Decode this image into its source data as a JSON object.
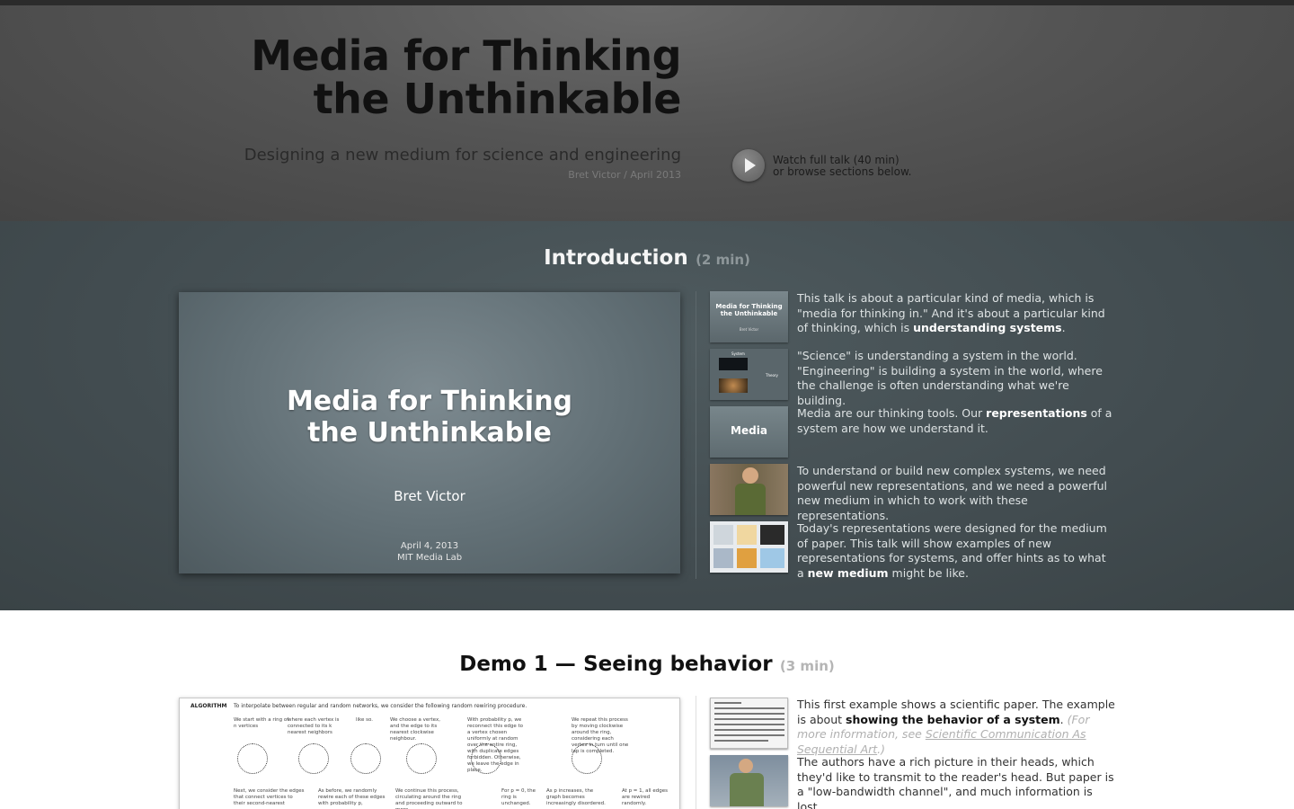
{
  "header": {
    "title_line1": "Media for Thinking",
    "title_line2": "the Unthinkable",
    "subtitle": "Designing a new medium for science and engineering",
    "byline": "Bret Victor / April 2013",
    "watch_line1": "Watch full talk (40 min)",
    "watch_line2": "or browse sections below."
  },
  "intro": {
    "title": "Introduction",
    "duration": "(2 min)",
    "slide": {
      "title_line1": "Media for Thinking",
      "title_line2": "the Unthinkable",
      "author": "Bret Victor",
      "date": "April 4, 2013",
      "venue": "MIT Media Lab"
    },
    "thumbs": {
      "t1_title": "Media for Thinking the Unthinkable",
      "t1_sub": "Bret Victor",
      "t2_system": "System",
      "t2_theory": "Theory",
      "t3_label": "Media"
    },
    "items": [
      {
        "pre": "This talk is about a particular kind of media, which is \"media for thinking in.\" And it's about a particular kind of thinking, which is ",
        "bold": "understanding systems",
        "post": "."
      },
      {
        "pre": "\"Science\" is understanding a system in the world. \"Engineering\" is building a system in the world, where the challenge is often understanding what we're building.",
        "bold": "",
        "post": ""
      },
      {
        "pre": "Media are our thinking tools. Our ",
        "bold": "representations",
        "post": " of a system are how we understand it."
      },
      {
        "pre": "To understand or build new complex systems, we need powerful new representations, and we need a powerful new medium in which to work with these representations.",
        "bold": "",
        "post": ""
      },
      {
        "pre": "Today's representations were designed for the medium of paper. This talk will show examples of new representations for systems, and offer hints as to what a ",
        "bold": "new medium",
        "post": " might be like."
      }
    ]
  },
  "demo1": {
    "prefix": "Demo 1 —",
    "title": "Seeing behavior",
    "duration": "(3 min)",
    "paper": {
      "algo_label": "ALGORITHM",
      "algo_text": "To interpolate between regular and random networks, we consider the following random rewiring procedure.",
      "steps": [
        "We start with a ring of n vertices",
        "where each vertex is connected to its k nearest neighbors",
        "like so.",
        "We choose a vertex, and the edge to its nearest clockwise neighbour.",
        "With probability p, we reconnect this edge to a vertex chosen uniformly at random over the entire ring, with duplicate edges forbidden. Otherwise, we leave the edge in place.",
        "We repeat this process by moving clockwise around the ring, considering each vertex in turn until one lap is completed."
      ],
      "notes": [
        "Next, we consider the edges that connect vertices to their second-nearest",
        "As before, we randomly rewire each of these edges with probability p,",
        "We continue this process, circulating around the ring and proceeding outward to more",
        "For p = 0, the ring is unchanged.",
        "As p increases, the graph becomes increasingly disordered.",
        "At p = 1, all edges are rewired randomly."
      ]
    },
    "item1": {
      "pre": "This first example shows a scientific paper. The example is about ",
      "bold": "showing the behavior of a system",
      "post": ".",
      "aside_pre": " (For more information, see ",
      "aside_link": "Scientific Communication As Sequential Art",
      "aside_post": ".)"
    },
    "item2": "The authors have a rich picture in their heads, which they'd like to transmit to the reader's head. But paper is a \"low-bandwidth channel\", and much information is lost."
  }
}
